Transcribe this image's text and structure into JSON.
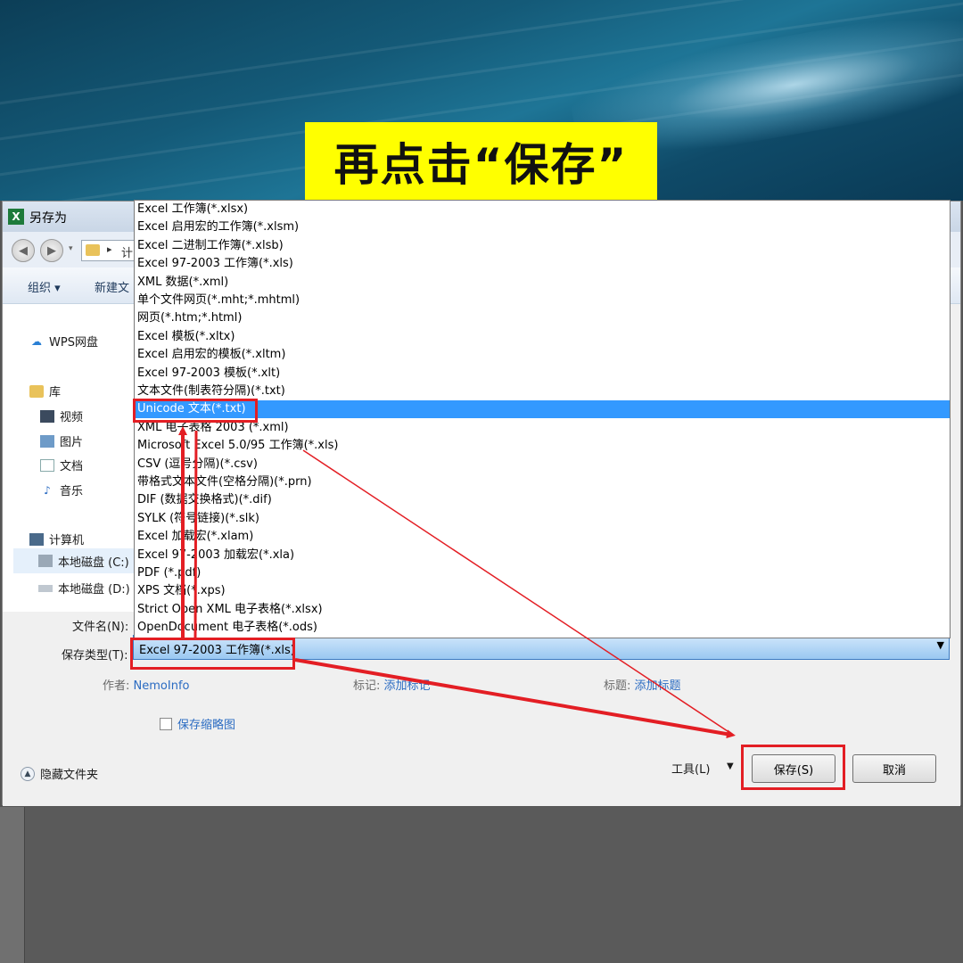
{
  "caption": "再点击“保存”",
  "dialog": {
    "title": "另存为",
    "app_icon_letter": "X",
    "breadcrumb": "计",
    "toolbar": {
      "organize": "组织 ▾",
      "new_folder": "新建文"
    },
    "sidebar": [
      {
        "icon": "cloud-icon",
        "label": "WPS网盘"
      },
      {
        "icon": "library-icon",
        "label": "库"
      },
      {
        "icon": "video-icon",
        "label": "视频"
      },
      {
        "icon": "picture-icon",
        "label": "图片"
      },
      {
        "icon": "document-icon",
        "label": "文档"
      },
      {
        "icon": "music-icon",
        "label": "音乐"
      },
      {
        "icon": "computer-icon",
        "label": "计算机"
      },
      {
        "icon": "local-disk-icon",
        "label": "本地磁盘 (C:)"
      },
      {
        "icon": "local-disk-icon",
        "label": "本地磁盘 (D:)"
      }
    ],
    "filename_label": "文件名(N):",
    "savetype_label": "保存类型(T):",
    "savetype_value": "Excel 97-2003 工作簿(*.xls)",
    "author_label": "作者:",
    "author_value": "NemoInfo",
    "tags_label": "标记:",
    "tags_value": "添加标记",
    "title_label": "标题:",
    "title_value": "添加标题",
    "thumbnail_label": "保存缩略图",
    "hide_folders": "隐藏文件夹",
    "tools": "工具(L)",
    "save_button": "保存(S)",
    "cancel_button": "取消"
  },
  "dropdown_options": [
    "Excel 工作簿(*.xlsx)",
    "Excel 启用宏的工作簿(*.xlsm)",
    "Excel 二进制工作簿(*.xlsb)",
    "Excel 97-2003 工作簿(*.xls)",
    "XML 数据(*.xml)",
    "单个文件网页(*.mht;*.mhtml)",
    "网页(*.htm;*.html)",
    "Excel 模板(*.xltx)",
    "Excel 启用宏的模板(*.xltm)",
    "Excel 97-2003 模板(*.xlt)",
    "文本文件(制表符分隔)(*.txt)",
    "Unicode 文本(*.txt)",
    "XML 电子表格 2003 (*.xml)",
    "Microsoft Excel 5.0/95 工作簿(*.xls)",
    "CSV (逗号分隔)(*.csv)",
    "带格式文本文件(空格分隔)(*.prn)",
    "DIF (数据交换格式)(*.dif)",
    "SYLK (符号链接)(*.slk)",
    "Excel 加载宏(*.xlam)",
    "Excel 97-2003 加载宏(*.xla)",
    "PDF (*.pdf)",
    "XPS 文档(*.xps)",
    "Strict Open XML 电子表格(*.xlsx)",
    "OpenDocument 电子表格(*.ods)"
  ],
  "highlighted_option_index": 11,
  "annotation_color": "#e31e24",
  "highlight_color": "#3399ff"
}
